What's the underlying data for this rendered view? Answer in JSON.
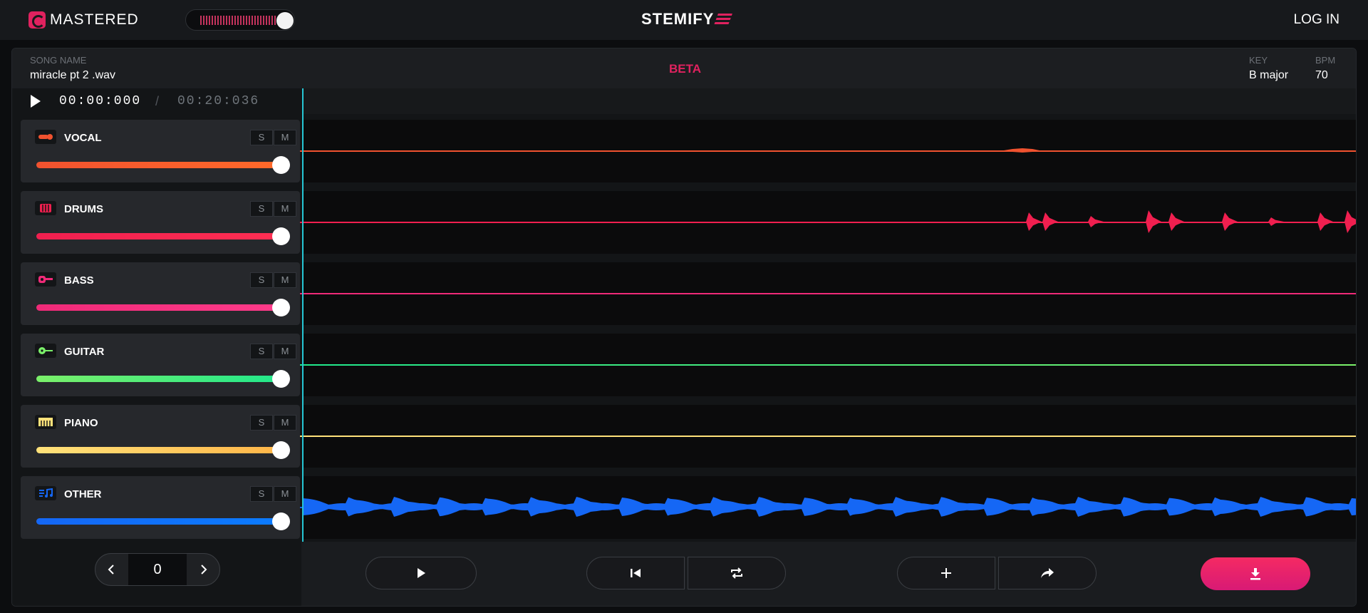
{
  "app": {
    "logo_text": "MASTERED",
    "brand": "STEMIFY",
    "login_label": "LOG IN",
    "beta_label": "BETA"
  },
  "master_volume": {
    "level": 1.0
  },
  "song": {
    "name_label": "SONG NAME",
    "name": "miracle pt 2 .wav",
    "key_label": "KEY",
    "key": "B major",
    "bpm_label": "BPM",
    "bpm": "70"
  },
  "transport": {
    "current_time": "00:00:000",
    "separator": "/",
    "total_time": "00:20:036",
    "playhead_position": 0.0
  },
  "tracks": [
    {
      "name": "VOCAL",
      "icon": "microphone-icon",
      "color": "#f0522f",
      "color2": "#ff6a2a",
      "solo": "S",
      "mute": "M",
      "volume": 1.0
    },
    {
      "name": "DRUMS",
      "icon": "drum-icon",
      "color": "#f01f4f",
      "color2": "#ff2f52",
      "solo": "S",
      "mute": "M",
      "volume": 1.0
    },
    {
      "name": "BASS",
      "icon": "bass-guitar-icon",
      "color": "#ef2a78",
      "color2": "#ff3b8a",
      "solo": "S",
      "mute": "M",
      "volume": 1.0
    },
    {
      "name": "GUITAR",
      "icon": "guitar-icon",
      "color": "#7bf06a",
      "color2": "#1fe88c",
      "solo": "S",
      "mute": "M",
      "volume": 1.0
    },
    {
      "name": "PIANO",
      "icon": "piano-icon",
      "color": "#ffe27a",
      "color2": "#ffb547",
      "solo": "S",
      "mute": "M",
      "volume": 1.0
    },
    {
      "name": "OTHER",
      "icon": "music-note-icon",
      "color": "#1567f5",
      "color2": "#0b7cff",
      "solo": "S",
      "mute": "M",
      "volume": 1.0
    }
  ],
  "pitch_stepper": {
    "value": "0"
  },
  "bottom_buttons": [
    "play-icon",
    "skip-back-icon",
    "loop-icon",
    "plus-icon",
    "share-icon",
    "download-icon"
  ]
}
